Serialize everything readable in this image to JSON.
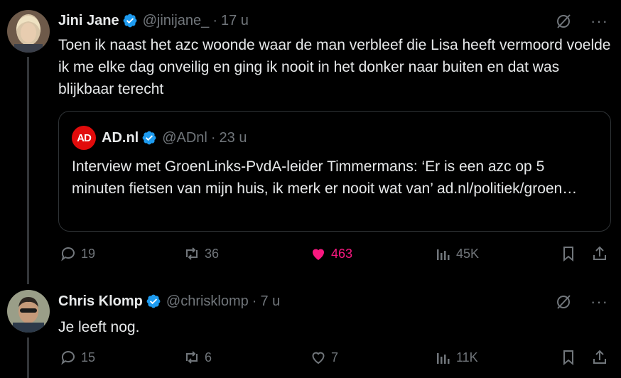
{
  "tweets": [
    {
      "author_name": "Jini Jane",
      "handle": "@jinijane_",
      "separator": "·",
      "time": "17 u",
      "text": "Toen ik naast het azc woonde waar de man verbleef die Lisa heeft vermoord voelde ik me elke dag onveilig en ging ik nooit in het donker naar buiten en dat was blijkbaar terecht",
      "quote": {
        "logo_text": "AD",
        "author_name": "AD.nl",
        "handle": "@ADnl",
        "separator": "·",
        "time": "23 u",
        "text": "Interview met GroenLinks-PvdA-leider Timmermans: ‘Er is een azc op 5 minuten fietsen van mijn huis, ik merk er nooit wat van’ ad.nl/politiek/groen…"
      },
      "replies": "19",
      "reposts": "36",
      "likes": "463",
      "views": "45K",
      "liked": true
    },
    {
      "author_name": "Chris Klomp",
      "handle": "@chrisklomp",
      "separator": "·",
      "time": "7 u",
      "text": "Je leeft nog.",
      "replies": "15",
      "reposts": "6",
      "likes": "7",
      "views": "11K",
      "liked": false
    }
  ],
  "colors": {
    "background": "#000000",
    "text": "#e7e9ea",
    "muted": "#71767b",
    "verified": "#1d9bf0",
    "like": "#f91880",
    "ad_brand": "#e10b0b"
  },
  "more_icon": "···"
}
